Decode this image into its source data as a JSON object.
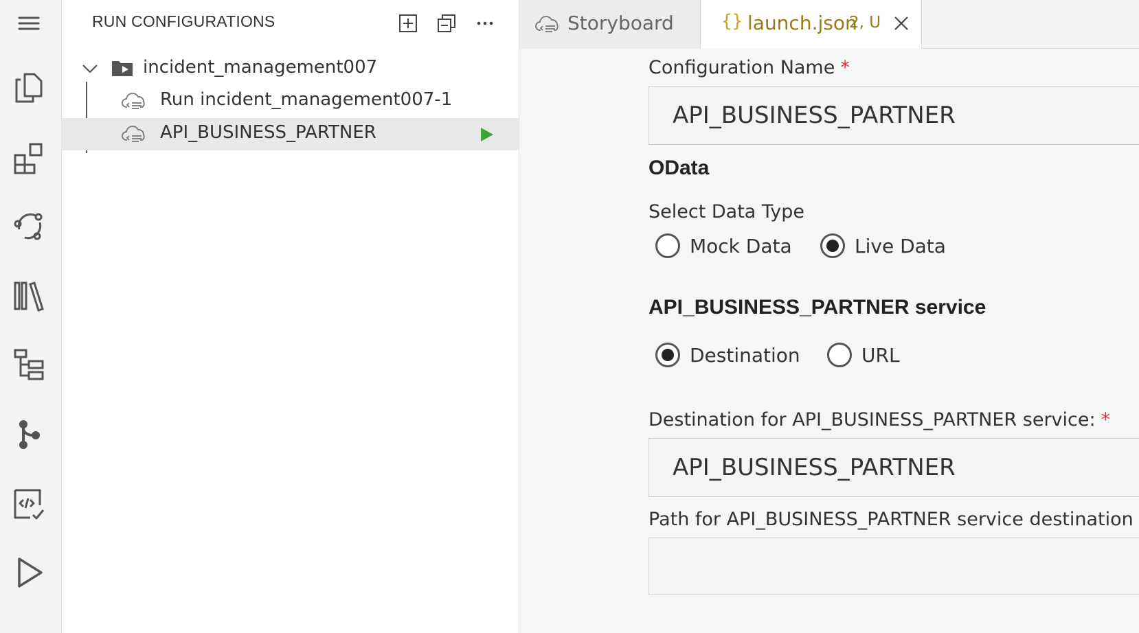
{
  "sidebar": {
    "title": "RUN CONFIGURATIONS",
    "tree": {
      "folder_label": "incident_management007",
      "items": [
        {
          "label": "Run incident_management007-1"
        },
        {
          "label": "API_BUSINESS_PARTNER"
        }
      ]
    }
  },
  "tabs": [
    {
      "label": "Storyboard"
    },
    {
      "label": "launch.json",
      "badge": "2, U",
      "icon_text": "{}"
    }
  ],
  "form": {
    "config_name_label": "Configuration Name",
    "config_name_value": "API_BUSINESS_PARTNER",
    "required_mark": "*",
    "odata_heading": "OData",
    "data_type_label": "Select Data Type",
    "data_type_options": [
      {
        "label": "Mock Data",
        "selected": false
      },
      {
        "label": "Live Data",
        "selected": true
      }
    ],
    "service_heading": "API_BUSINESS_PARTNER service",
    "service_options": [
      {
        "label": "Destination",
        "selected": true
      },
      {
        "label": "URL",
        "selected": false
      }
    ],
    "destination_label": "Destination for API_BUSINESS_PARTNER service:",
    "destination_value": "API_BUSINESS_PARTNER",
    "path_label": "Path for API_BUSINESS_PARTNER service destination",
    "path_value": ""
  },
  "colors": {
    "run_green": "#3fa33a",
    "required_red": "#d9363e",
    "json_tab_gold": "#9a7b16"
  }
}
